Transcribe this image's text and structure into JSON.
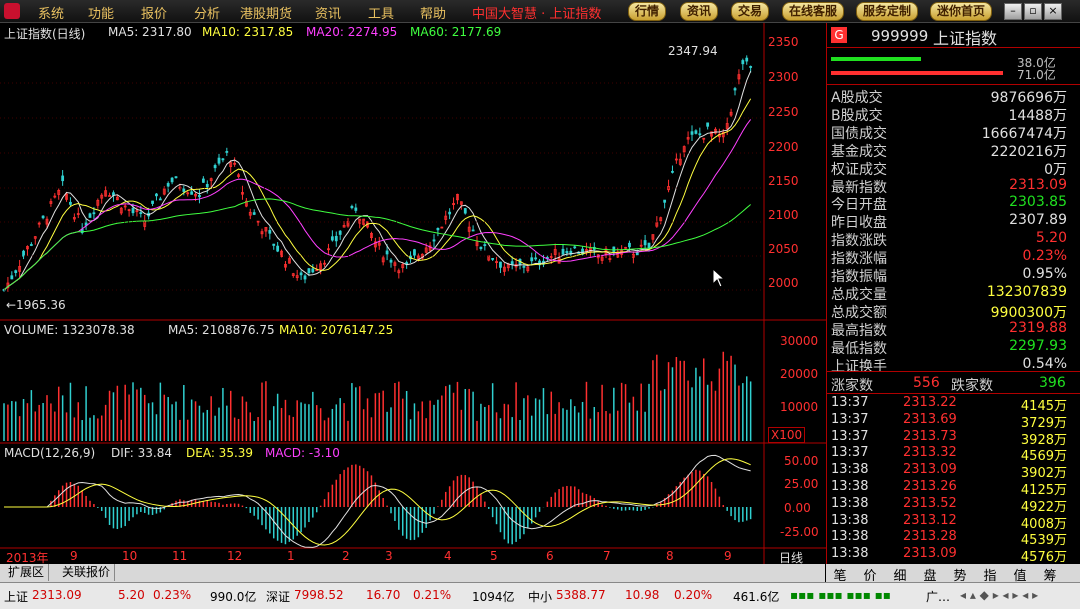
{
  "menu": {
    "items": [
      "系统",
      "功能",
      "报价",
      "分析",
      "港股期货",
      "资讯",
      "工具",
      "帮助"
    ],
    "promo": "中国大智慧 · 上证指数",
    "pills": [
      "行情",
      "资讯",
      "交易",
      "在线客服",
      "服务定制",
      "迷你首页"
    ]
  },
  "main": {
    "title": "上证指数(日线)",
    "ma5": "MA5: 2317.80",
    "ma10": "MA10: 2317.85",
    "ma20": "MA20: 2274.95",
    "ma60": "MA60: 2177.69",
    "high_label": "2347.94",
    "low_label": "←1965.36",
    "yticks": [
      "2350",
      "2300",
      "2250",
      "2200",
      "2150",
      "2100",
      "2050",
      "2000"
    ],
    "volume_line": "VOLUME: 1323078.38",
    "vol_ma5": "MA5: 2108876.75",
    "vol_ma10": "MA10: 2076147.25",
    "vol_ticks": [
      "30000",
      "20000",
      "10000"
    ],
    "vol_unit": "X100",
    "macd_title": "MACD(12,26,9)",
    "macd_dif": "DIF: 33.84",
    "macd_dea": "DEA: 35.39",
    "macd_val": "MACD: -3.10",
    "macd_ticks": [
      "50.00",
      "25.00",
      "0.00",
      "-25.00"
    ],
    "xlabels": [
      "2013年",
      "9",
      "10",
      "11",
      "12",
      "1",
      "2",
      "3",
      "4",
      "5",
      "6",
      "7",
      "8",
      "9"
    ],
    "period": "日线"
  },
  "tabs": [
    "扩展区",
    "关联报价"
  ],
  "right": {
    "code": "999999",
    "name": "上证指数",
    "badge": "G",
    "bar1": "38.0亿",
    "bar2": "71.0亿",
    "stats": [
      {
        "label": "A股成交",
        "value": "9876696万",
        "color": "white"
      },
      {
        "label": "B股成交",
        "value": "14488万",
        "color": "white"
      },
      {
        "label": "国债成交",
        "value": "16667474万",
        "color": "white"
      },
      {
        "label": "基金成交",
        "value": "2220216万",
        "color": "white"
      },
      {
        "label": "权证成交",
        "value": "0万",
        "color": "white"
      },
      {
        "label": "最新指数",
        "value": "2313.09",
        "color": "red"
      },
      {
        "label": "今日开盘",
        "value": "2303.85",
        "color": "green"
      },
      {
        "label": "昨日收盘",
        "value": "2307.89",
        "color": "white"
      },
      {
        "label": "指数涨跌",
        "value": "5.20",
        "color": "red"
      },
      {
        "label": "指数涨幅",
        "value": "0.23%",
        "color": "red"
      },
      {
        "label": "指数振幅",
        "value": "0.95%",
        "color": "white"
      },
      {
        "label": "总成交量",
        "value": "132307839",
        "color": "yellow"
      },
      {
        "label": "总成交额",
        "value": "9900300万",
        "color": "yellow"
      },
      {
        "label": "最高指数",
        "value": "2319.88",
        "color": "red"
      },
      {
        "label": "最低指数",
        "value": "2297.93",
        "color": "green"
      },
      {
        "label": "上证换手",
        "value": "0.54%",
        "color": "white"
      }
    ],
    "up_label": "涨家数",
    "up_count": "556",
    "down_label": "跌家数",
    "down_count": "396",
    "ticks": [
      {
        "time": "13:37",
        "price": "2313.22",
        "vol": "4145万"
      },
      {
        "time": "13:37",
        "price": "2313.69",
        "vol": "3729万"
      },
      {
        "time": "13:37",
        "price": "2313.73",
        "vol": "3928万"
      },
      {
        "time": "13:37",
        "price": "2313.32",
        "vol": "4569万"
      },
      {
        "time": "13:38",
        "price": "2313.09",
        "vol": "3902万"
      },
      {
        "time": "13:38",
        "price": "2313.26",
        "vol": "4125万"
      },
      {
        "time": "13:38",
        "price": "2313.52",
        "vol": "4922万"
      },
      {
        "time": "13:38",
        "price": "2313.12",
        "vol": "4008万"
      },
      {
        "time": "13:38",
        "price": "2313.28",
        "vol": "4539万"
      },
      {
        "time": "13:38",
        "price": "2313.09",
        "vol": "4576万"
      }
    ],
    "tabs": [
      "笔",
      "价",
      "细",
      "盘",
      "势",
      "指",
      "值",
      "筹"
    ]
  },
  "bottom": {
    "sh_label": "上证",
    "sh_price": "2313.09",
    "sh_chg": "5.20",
    "sh_pct": "0.23%",
    "sh_amt": "990.0亿",
    "sz_label": "深证",
    "sz_price": "7998.52",
    "sz_chg": "16.70",
    "sz_pct": "0.21%",
    "sz_amt": "1094亿",
    "zx_label": "中小",
    "zx_price": "5388.77",
    "zx_chg": "10.98",
    "zx_pct": "0.20%",
    "zx_amt": "461.6亿",
    "tail": "广…"
  }
}
